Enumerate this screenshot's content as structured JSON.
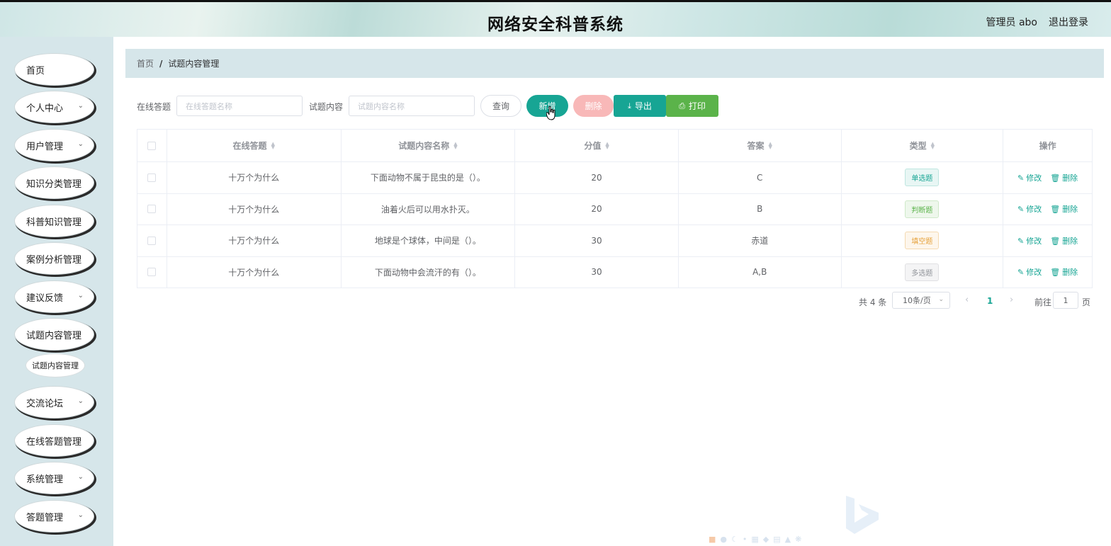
{
  "header": {
    "title": "网络安全科普系统",
    "user": "管理员 abo",
    "logout": "退出登录"
  },
  "sidebar": {
    "items": [
      {
        "label": "首页",
        "expandable": false
      },
      {
        "label": "个人中心",
        "expandable": true
      },
      {
        "label": "用户管理",
        "expandable": true
      },
      {
        "label": "知识分类管理",
        "expandable": false
      },
      {
        "label": "科普知识管理",
        "expandable": false
      },
      {
        "label": "案例分析管理",
        "expandable": false
      },
      {
        "label": "建议反馈",
        "expandable": true
      },
      {
        "label": "试题内容管理",
        "expandable": false
      },
      {
        "label": "交流论坛",
        "expandable": true
      },
      {
        "label": "在线答题管理",
        "expandable": false
      },
      {
        "label": "系统管理",
        "expandable": true
      },
      {
        "label": "答题管理",
        "expandable": true
      }
    ],
    "sub_item": "试题内容管理"
  },
  "breadcrumb": {
    "home": "首页",
    "separator": "/",
    "current": "试题内容管理"
  },
  "filters": {
    "exam_label": "在线答题",
    "exam_placeholder": "在线答题名称",
    "content_label": "试题内容",
    "content_placeholder": "试题内容名称"
  },
  "buttons": {
    "query": "查询",
    "add": "新增",
    "delete": "删除",
    "export": "导出",
    "print": "打印"
  },
  "table": {
    "columns": [
      "在线答题",
      "试题内容名称",
      "分值",
      "答案",
      "类型",
      "操作"
    ],
    "rows": [
      {
        "exam": "十万个为什么",
        "name": "下面动物不属于昆虫的是（）。",
        "score": "20",
        "answer": "C",
        "type": "单选题"
      },
      {
        "exam": "十万个为什么",
        "name": "油着火后可以用水扑灭。",
        "score": "20",
        "answer": "B",
        "type": "判断题"
      },
      {
        "exam": "十万个为什么",
        "name": "地球是个球体，中间是（）。",
        "score": "30",
        "answer": "赤道",
        "type": "填空题"
      },
      {
        "exam": "十万个为什么",
        "name": "下面动物中会流汗的有（）。",
        "score": "30",
        "answer": "A,B",
        "type": "多选题"
      }
    ],
    "row_actions": {
      "edit": "修改",
      "delete": "删除"
    }
  },
  "tag_colors": {
    "单选题": {
      "text": "#17a594",
      "bg": "#e8f6f4",
      "border": "#bfe6e0"
    },
    "判断题": {
      "text": "#5bb34a",
      "bg": "#eef7ec",
      "border": "#cfe9c9"
    },
    "填空题": {
      "text": "#e6a23c",
      "bg": "#fdf6ec",
      "border": "#f5dab1"
    },
    "多选题": {
      "text": "#909399",
      "bg": "#f4f4f5",
      "border": "#e0e0e3"
    }
  },
  "pagination": {
    "total": "共 4 条",
    "page_size": "10条/页",
    "current_page": "1",
    "goto_label": "前往",
    "goto_value": "1",
    "goto_suffix": "页"
  }
}
